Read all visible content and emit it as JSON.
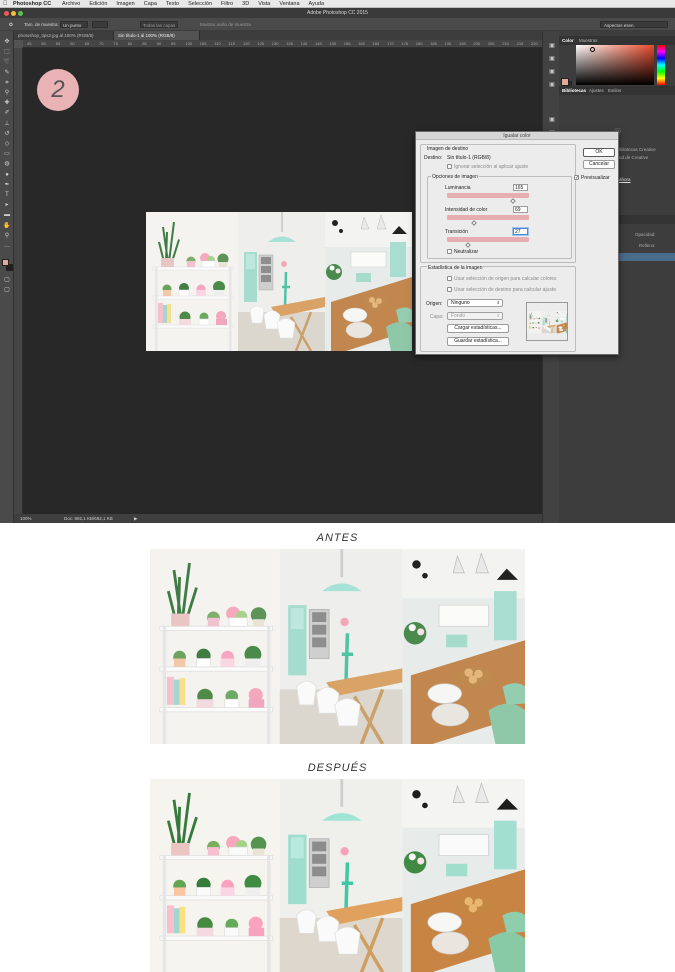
{
  "menubar": {
    "app_name": "Photoshop CC",
    "menus": [
      "Archivo",
      "Edición",
      "Imagen",
      "Capa",
      "Texto",
      "Selección",
      "Filtro",
      "3D",
      "Vista",
      "Ventana",
      "Ayuda"
    ]
  },
  "window": {
    "title": "Adobe Photoshop CC 2015"
  },
  "options_bar": {
    "size_label": "Tam. de muestra:",
    "size_value": "Un punto",
    "layer_value": "Todas las capas",
    "show_ring": "Mostrar anillo de muestra",
    "workspace": "Aspectos esen."
  },
  "doc_tabs": [
    "photoshop_tips2.jpg al 100% (RGB/8)",
    "Sin título-1 al 100% (RGB/8)"
  ],
  "rulers": [
    "45",
    "50",
    "55",
    "60",
    "65",
    "70",
    "75",
    "80",
    "85",
    "90",
    "95",
    "100",
    "105",
    "110",
    "115",
    "120",
    "125",
    "130",
    "135",
    "140",
    "145",
    "150",
    "155",
    "160",
    "165",
    "170",
    "175",
    "180",
    "185",
    "190",
    "195",
    "200",
    "205",
    "210",
    "215",
    "220"
  ],
  "status": {
    "zoom": "100%",
    "doc": "Doc: 692,1 KB/692,1 KB"
  },
  "step_number": "2",
  "panels": {
    "color_tabs": [
      "Color",
      "Muestras"
    ],
    "library_tabs": [
      "Bibliotecas",
      "Ajustes",
      "Estilos"
    ],
    "cc_text_1": "ibliotecas Creative",
    "cc_text_2": "ud de Creative",
    "cc_link": "ahora",
    "opacity_label": "Opacidad:",
    "fill_label": "Relleno:"
  },
  "dialog": {
    "title": "Igualar color",
    "dest_group": "Imagen de destino",
    "dest_label": "Destino:",
    "dest_value": "Sin título-1 (RGB/8)",
    "ignore_selection": "Ignorar selección al aplicar ajuste",
    "options_group": "Opciones de imagen",
    "luminance_label": "Luminancia",
    "luminance_value": "165",
    "intensity_label": "Intensidad de color",
    "intensity_value": "69",
    "transition_label": "Transición",
    "transition_value": "27",
    "neutralize": "Neutralizar",
    "stats_group": "Estadística de la imagen",
    "use_source_sel": "Usar selección de origen para calcular colores",
    "use_dest_sel": "Usar selección de destino para calcular ajuste",
    "source_label": "Origen:",
    "source_value": "Ninguno",
    "layer_label": "Capa:",
    "layer_value": "Fondo",
    "load_stats": "Cargar estadísticas...",
    "save_stats": "Guardar estadística...",
    "ok": "OK",
    "cancel": "Cancelar",
    "preview": "Previsualizar",
    "preview_checked": true,
    "slider_levels": {
      "luminance": 0.82,
      "intensity": 0.34,
      "transition": 0.27
    }
  },
  "captions": {
    "before": "ANTES",
    "after": "DESPUÉS"
  }
}
